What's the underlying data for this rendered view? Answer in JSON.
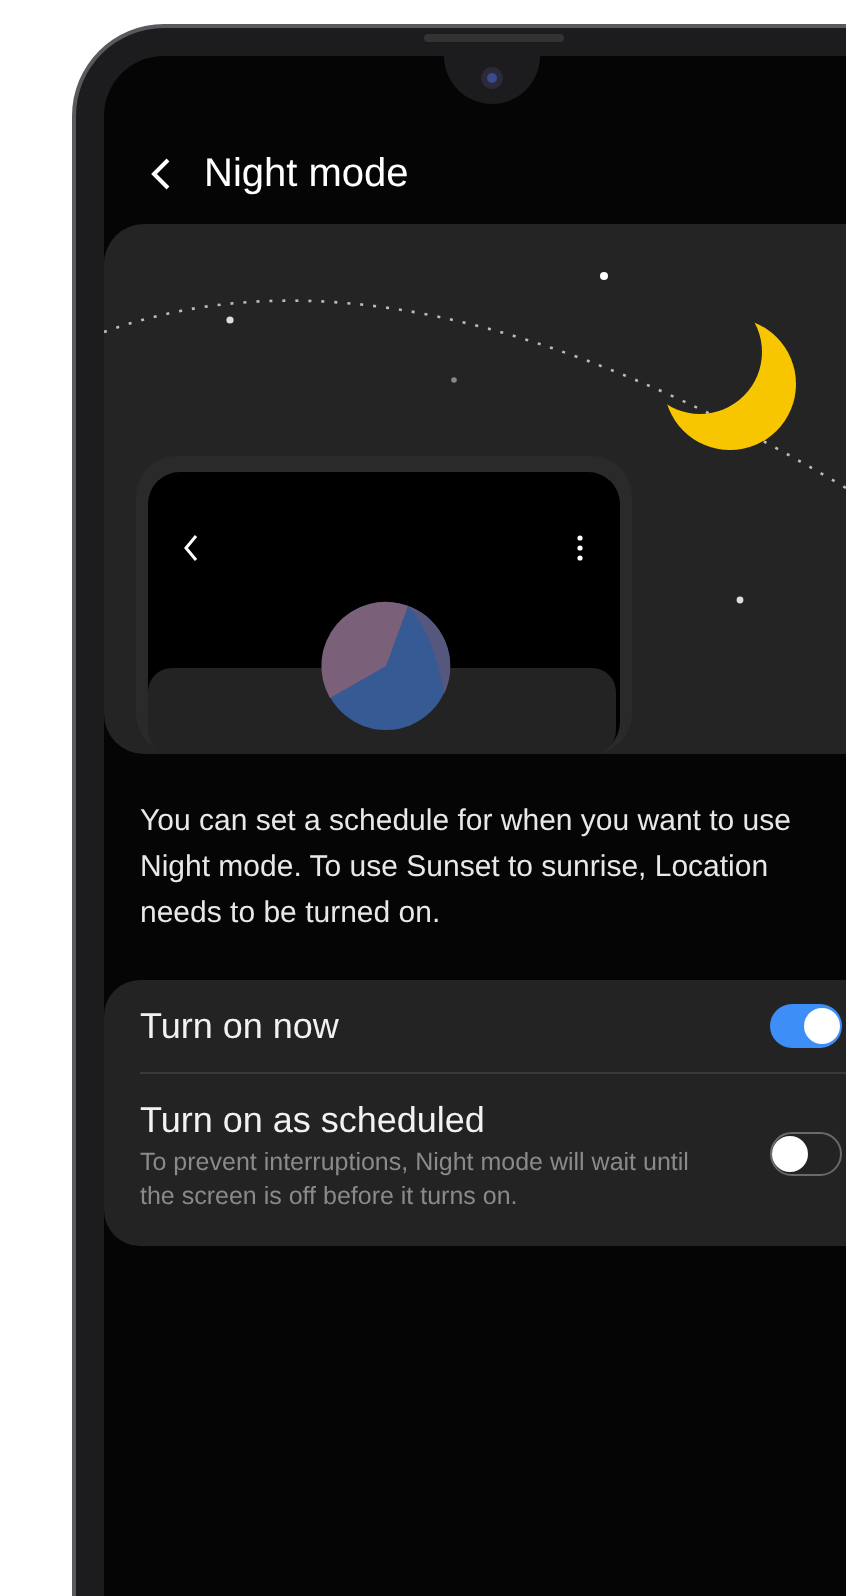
{
  "header": {
    "title": "Night mode"
  },
  "description": "You can set a schedule for when you want to use Night mode. To use Sunset to sunrise, Location needs to be turned on.",
  "settings": [
    {
      "title": "Turn on now",
      "on": true
    },
    {
      "title": "Turn on as scheduled",
      "subtitle": "To prevent interruptions, Night mode will wait until the screen is off before it turns on.",
      "on": false
    }
  ]
}
